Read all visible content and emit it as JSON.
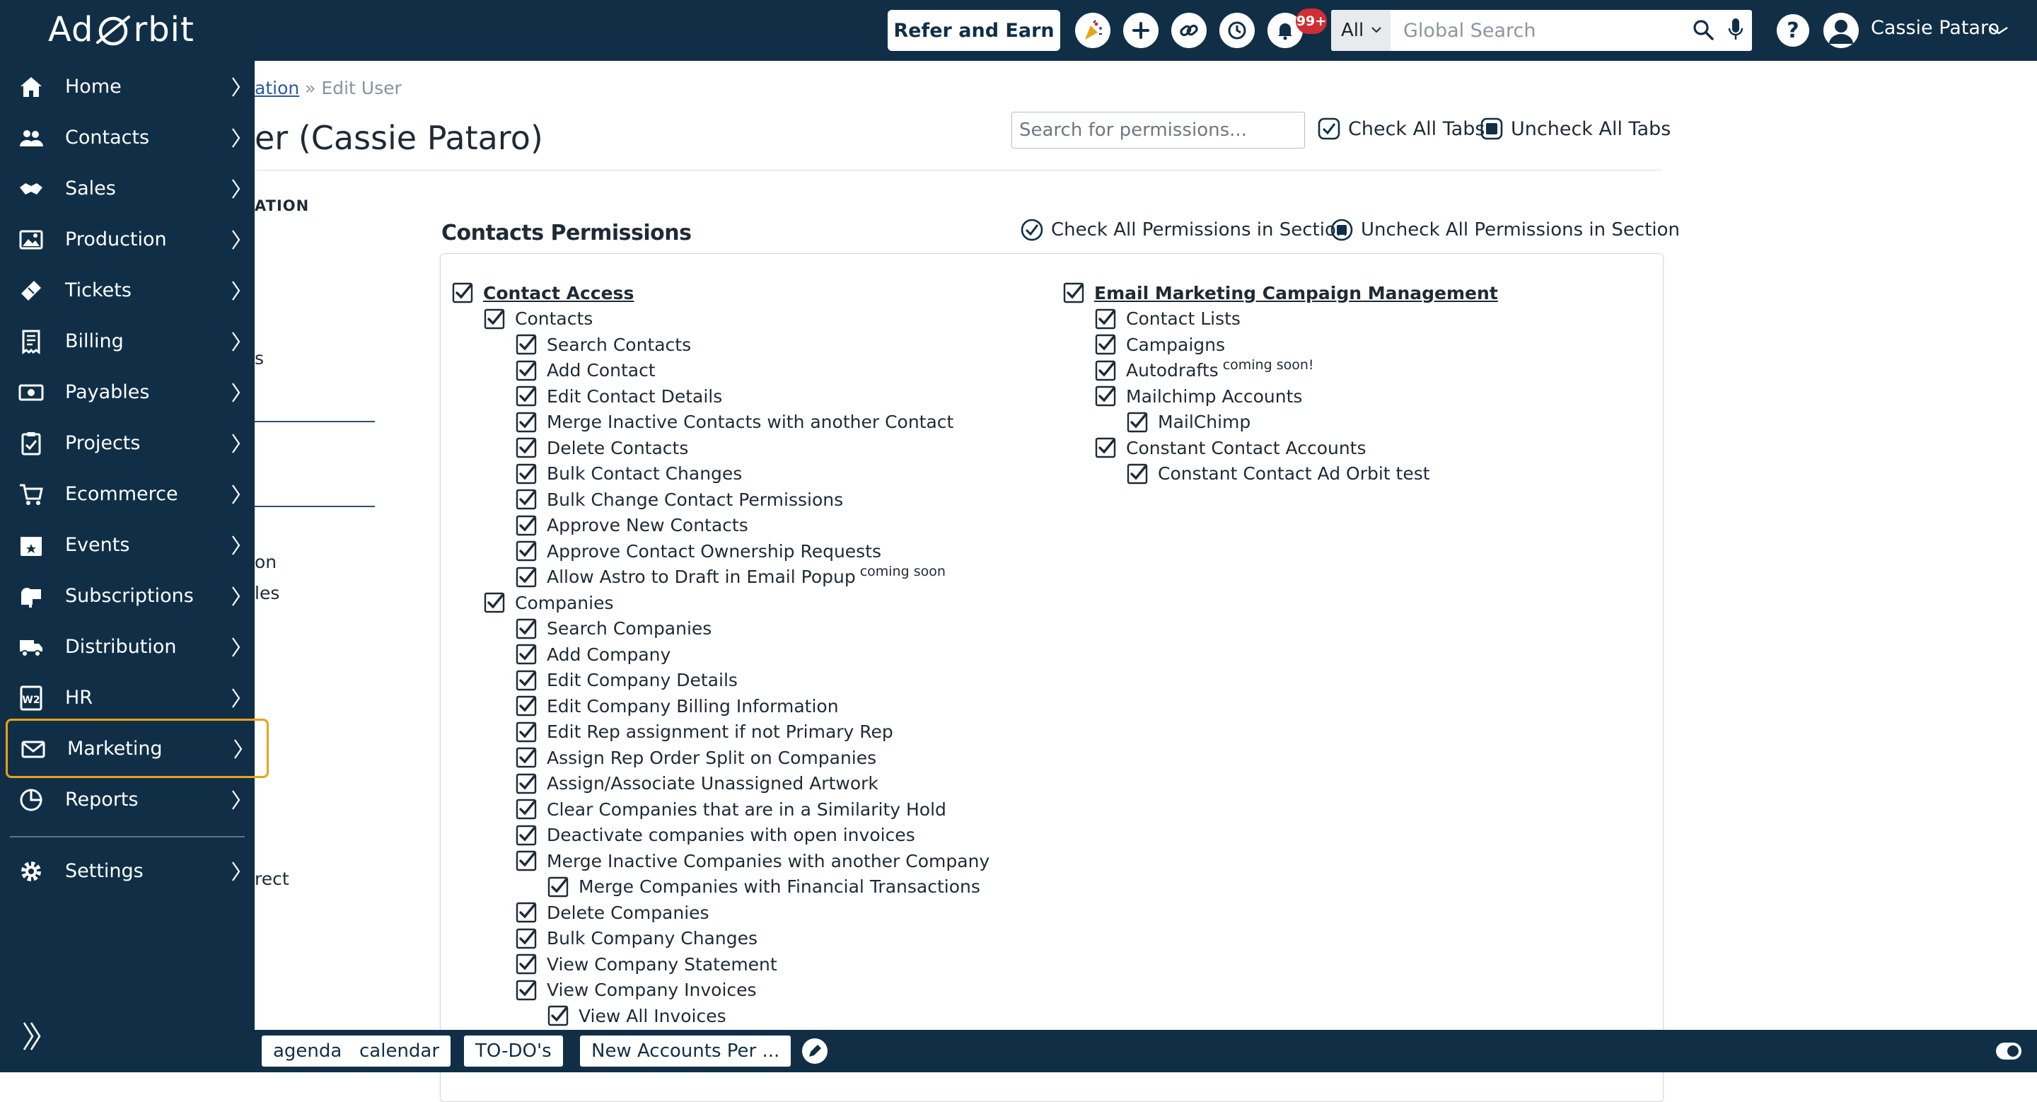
{
  "header": {
    "refer_label": "Refer and Earn",
    "notification_count": "99+",
    "search_scope": "All",
    "search_placeholder": "Global Search",
    "user_name": "Cassie Pataro"
  },
  "breadcrumb": {
    "parent": "ation",
    "separator": "»",
    "current": "Edit User"
  },
  "page_title": "er (Cassie Pataro)",
  "permissions_search_placeholder": "Search for permissions...",
  "check_all_tabs": "Check All Tabs",
  "uncheck_all_tabs": "Uncheck All Tabs",
  "left_tabs": {
    "heading": "ATION",
    "fragments": [
      "s",
      "on",
      "les",
      "rect"
    ]
  },
  "section": {
    "title": "Contacts Permissions",
    "check_all": "Check All Permissions in Section",
    "uncheck_all": "Uncheck All Permissions in Section"
  },
  "permissions": {
    "left": [
      {
        "label": "Contact Access",
        "level": 0,
        "group": true
      },
      {
        "label": "Contacts",
        "level": 1
      },
      {
        "label": "Search Contacts",
        "level": 2
      },
      {
        "label": "Add Contact",
        "level": 2
      },
      {
        "label": "Edit Contact Details",
        "level": 2
      },
      {
        "label": "Merge Inactive Contacts with another Contact",
        "level": 2
      },
      {
        "label": "Delete Contacts",
        "level": 2
      },
      {
        "label": "Bulk Contact Changes",
        "level": 2
      },
      {
        "label": "Bulk Change Contact Permissions",
        "level": 2
      },
      {
        "label": "Approve New Contacts",
        "level": 2
      },
      {
        "label": "Approve Contact Ownership Requests",
        "level": 2
      },
      {
        "label": "Allow Astro to Draft in Email Popup",
        "level": 2,
        "note": "coming soon"
      },
      {
        "label": "Companies",
        "level": 1
      },
      {
        "label": "Search Companies",
        "level": 2
      },
      {
        "label": "Add Company",
        "level": 2
      },
      {
        "label": "Edit Company Details",
        "level": 2
      },
      {
        "label": "Edit Company Billing Information",
        "level": 2
      },
      {
        "label": "Edit Rep assignment if not Primary Rep",
        "level": 2
      },
      {
        "label": "Assign Rep Order Split on Companies",
        "level": 2
      },
      {
        "label": "Assign/Associate Unassigned Artwork",
        "level": 2
      },
      {
        "label": "Clear Companies that are in a Similarity Hold",
        "level": 2
      },
      {
        "label": "Deactivate companies with open invoices",
        "level": 2
      },
      {
        "label": "Merge Inactive Companies with another Company",
        "level": 2
      },
      {
        "label": "Merge Companies with Financial Transactions",
        "level": 3
      },
      {
        "label": "Delete Companies",
        "level": 2
      },
      {
        "label": "Bulk Company Changes",
        "level": 2
      },
      {
        "label": "View Company Statement",
        "level": 2
      },
      {
        "label": "View Company Invoices",
        "level": 2
      },
      {
        "label": "View All Invoices",
        "level": 3
      }
    ],
    "right": [
      {
        "label": "Email Marketing Campaign Management",
        "level": 0,
        "group": true
      },
      {
        "label": "Contact Lists",
        "level": 1
      },
      {
        "label": "Campaigns",
        "level": 1
      },
      {
        "label": "Autodrafts",
        "level": 1,
        "note": "coming soon!"
      },
      {
        "label": "Mailchimp Accounts",
        "level": 1
      },
      {
        "label": "MailChimp",
        "level": 2
      },
      {
        "label": "Constant Contact Accounts",
        "level": 1
      },
      {
        "label": "Constant Contact Ad Orbit test",
        "level": 2
      }
    ]
  },
  "sidebar": {
    "logo_left": "Ad",
    "logo_right": "rbit",
    "items": [
      {
        "label": "Home",
        "icon": "home-icon"
      },
      {
        "label": "Contacts",
        "icon": "contacts-icon"
      },
      {
        "label": "Sales",
        "icon": "handshake-icon"
      },
      {
        "label": "Production",
        "icon": "image-icon"
      },
      {
        "label": "Tickets",
        "icon": "ticket-icon"
      },
      {
        "label": "Billing",
        "icon": "invoice-icon"
      },
      {
        "label": "Payables",
        "icon": "money-icon"
      },
      {
        "label": "Projects",
        "icon": "clipboard-icon"
      },
      {
        "label": "Ecommerce",
        "icon": "cart-icon"
      },
      {
        "label": "Events",
        "icon": "calendar-star-icon"
      },
      {
        "label": "Subscriptions",
        "icon": "mailbox-icon"
      },
      {
        "label": "Distribution",
        "icon": "truck-icon"
      },
      {
        "label": "HR",
        "icon": "w2-form-icon"
      },
      {
        "label": "Marketing",
        "icon": "envelope-icon",
        "active": true
      },
      {
        "label": "Reports",
        "icon": "reports-icon"
      },
      {
        "label": "Settings",
        "icon": "gear-icon"
      }
    ]
  },
  "bottom_tabs": [
    "agenda",
    "calendar",
    "TO-DO's",
    "New Accounts Per ..."
  ],
  "colors": {
    "navy": "#102f47",
    "active_border": "#e8a21a",
    "badge": "#d12d34",
    "link": "#2c5aa0"
  }
}
